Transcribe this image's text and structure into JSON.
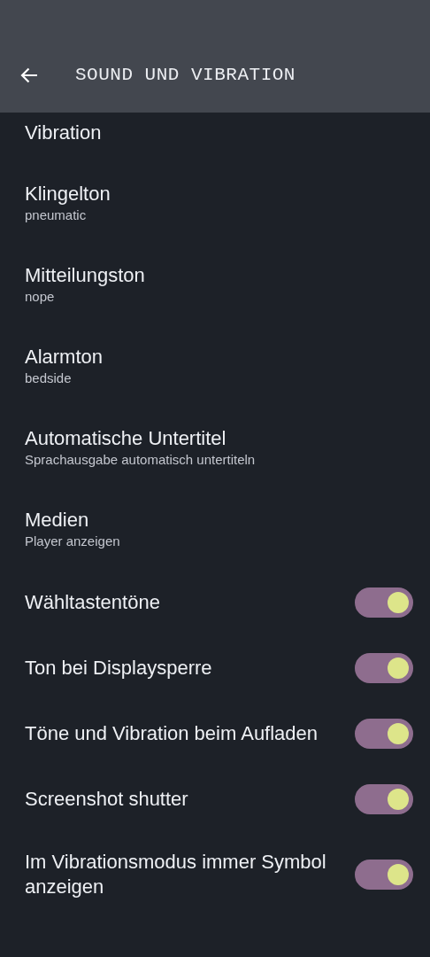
{
  "header": {
    "title": "SOUND UND VIBRATION"
  },
  "items": [
    {
      "kind": "plain",
      "title": "Vibration"
    },
    {
      "kind": "plain",
      "title": "Klingelton",
      "subtitle": "pneumatic"
    },
    {
      "kind": "plain",
      "title": "Mitteilungston",
      "subtitle": "nope"
    },
    {
      "kind": "plain",
      "title": "Alarmton",
      "subtitle": "bedside"
    },
    {
      "kind": "plain",
      "title": "Automatische Untertitel",
      "subtitle": "Sprachausgabe automatisch untertiteln"
    },
    {
      "kind": "plain",
      "title": "Medien",
      "subtitle": "Player anzeigen"
    },
    {
      "kind": "toggle",
      "title": "Wähltastentöne",
      "on": true
    },
    {
      "kind": "toggle",
      "title": "Ton bei Displaysperre",
      "on": true
    },
    {
      "kind": "toggle",
      "title": "Töne und Vibration beim Aufladen",
      "on": true
    },
    {
      "kind": "toggle",
      "title": "Screenshot shutter",
      "on": true
    },
    {
      "kind": "toggle",
      "title": "Im Vibrationsmodus immer Symbol anzeigen",
      "on": true
    }
  ]
}
